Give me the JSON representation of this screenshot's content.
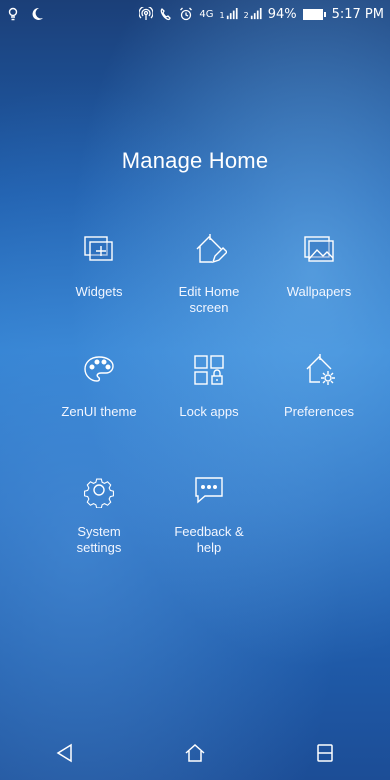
{
  "status_bar": {
    "left_icons": [
      "bulb-icon",
      "moon-icon"
    ],
    "right_icons": [
      "hotspot-icon",
      "call-icon",
      "alarm-icon",
      "data-icon",
      "signal-1-icon",
      "signal-2-icon"
    ],
    "battery_percent": "94%",
    "time": "5:17 PM",
    "signal_labels": [
      "4G",
      "1",
      "2"
    ]
  },
  "page": {
    "title": "Manage Home"
  },
  "tiles": [
    {
      "label": "Widgets",
      "icon": "widgets-icon"
    },
    {
      "label": "Edit Home\nscreen",
      "icon": "edit-home-icon"
    },
    {
      "label": "Wallpapers",
      "icon": "wallpapers-icon"
    },
    {
      "label": "ZenUI theme",
      "icon": "palette-icon"
    },
    {
      "label": "Lock apps",
      "icon": "lock-apps-icon"
    },
    {
      "label": "Preferences",
      "icon": "preferences-icon"
    },
    {
      "label": "System\nsettings",
      "icon": "gear-icon"
    },
    {
      "label": "Feedback &\nhelp",
      "icon": "feedback-icon"
    }
  ],
  "nav": {
    "buttons": [
      "back-icon",
      "home-icon",
      "recents-icon"
    ]
  }
}
